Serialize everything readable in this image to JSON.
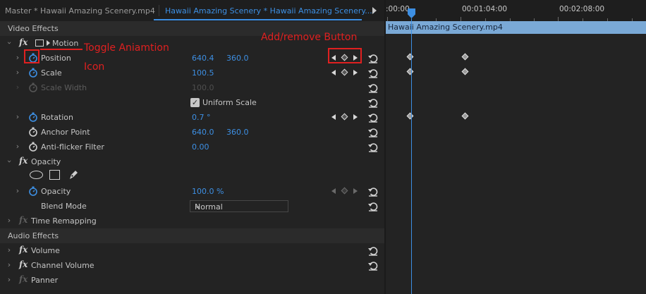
{
  "tabs": {
    "master": "Master * Hawaii Amazing Scenery.mp4",
    "sequence": "Hawaii Amazing Scenery * Hawaii Amazing Scenery...."
  },
  "sections": {
    "video": "Video Effects",
    "audio": "Audio Effects"
  },
  "fx_symbol": "fx",
  "motion": {
    "label": "Motion",
    "position": {
      "label": "Position",
      "x": "640.4",
      "y": "360.0"
    },
    "scale": {
      "label": "Scale",
      "value": "100.5"
    },
    "scale_width": {
      "label": "Scale Width",
      "value": "100.0"
    },
    "uniform_scale": {
      "label": "Uniform Scale",
      "checked": true
    },
    "rotation": {
      "label": "Rotation",
      "value": "0.7 °"
    },
    "anchor": {
      "label": "Anchor Point",
      "x": "640.0",
      "y": "360.0"
    },
    "flicker": {
      "label": "Anti-flicker Filter",
      "value": "0.00"
    }
  },
  "opacity": {
    "label": "Opacity",
    "opacity_prop": {
      "label": "Opacity",
      "value": "100.0 %"
    },
    "blend": {
      "label": "Blend Mode",
      "value": "Normal"
    }
  },
  "time_remapping": {
    "label": "Time Remapping"
  },
  "audio": {
    "volume": "Volume",
    "channel_volume": "Channel Volume",
    "panner": "Panner"
  },
  "timeline": {
    "times": [
      ":00:00",
      "00:01:04:00",
      "00:02:08:00"
    ],
    "clip_name": "Hawaii Amazing Scenery.mp4"
  },
  "annotations": {
    "toggle_line1": "Toggle Aniamtion",
    "toggle_line2": "Icon",
    "add_remove": "Add/remove Button"
  },
  "colors": {
    "accent": "#3d8fe3",
    "annotation": "#e02020",
    "clip": "#7aa9d6"
  }
}
